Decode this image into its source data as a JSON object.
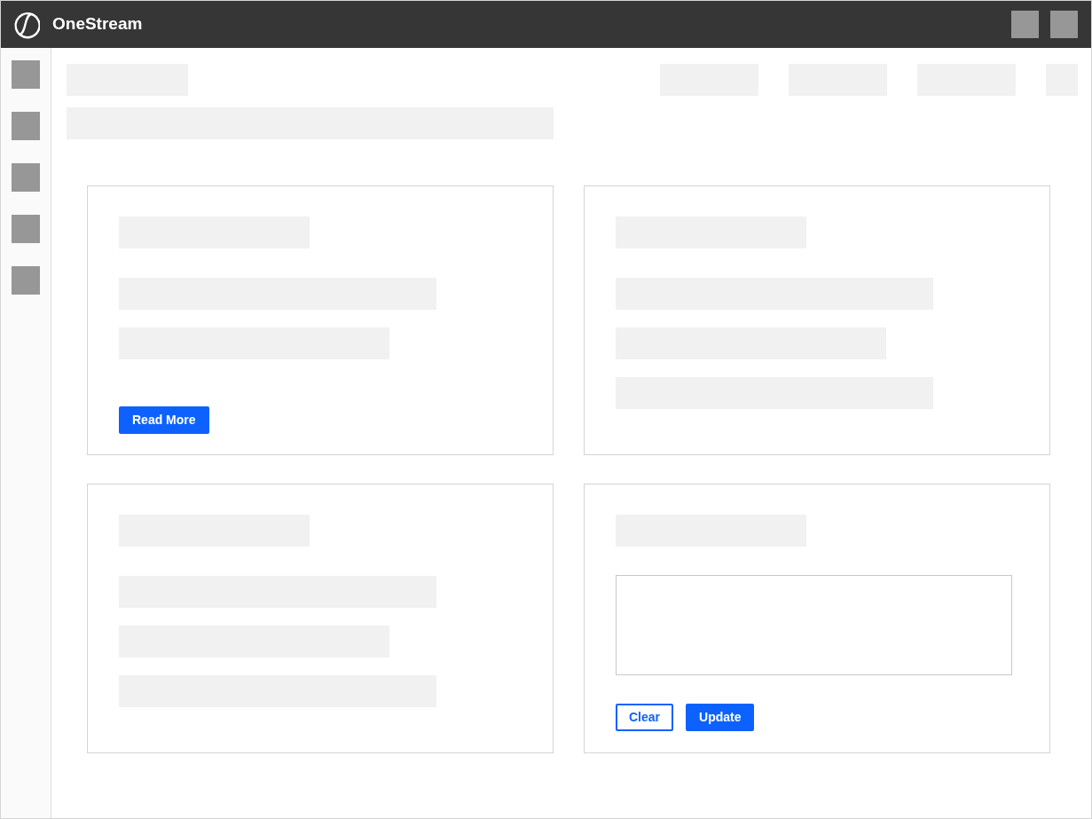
{
  "header": {
    "title": "OneStream"
  },
  "cards": [
    {
      "kind": "text",
      "button": "Read More"
    },
    {
      "kind": "text"
    },
    {
      "kind": "text"
    },
    {
      "kind": "form",
      "buttons": [
        {
          "label": "Clear",
          "kind": "secondary"
        },
        {
          "label": "Update",
          "kind": "primary"
        }
      ]
    }
  ]
}
